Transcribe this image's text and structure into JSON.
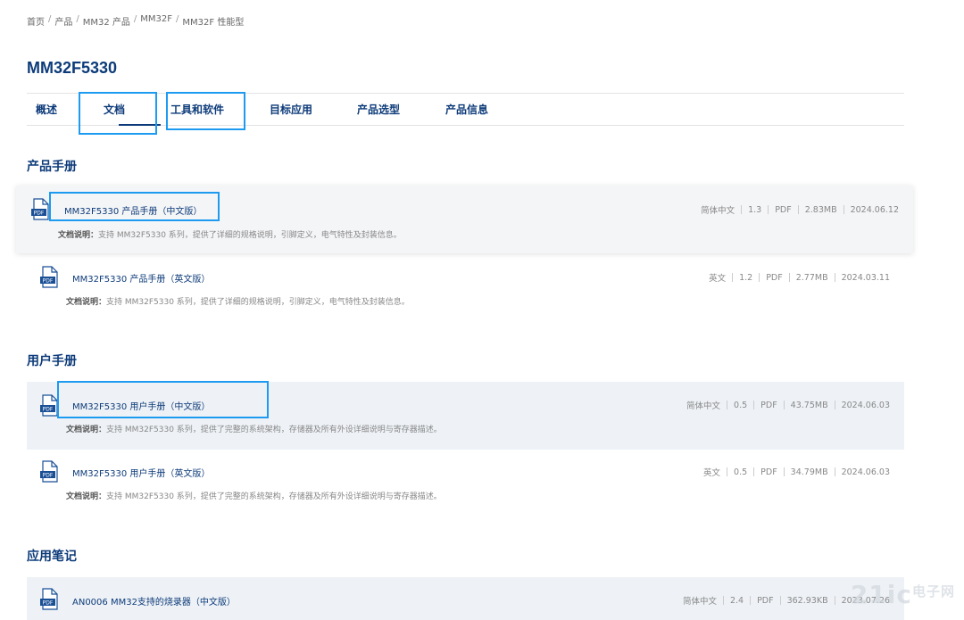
{
  "breadcrumb": [
    "首页",
    "产品",
    "MM32 产品",
    "MM32F",
    "MM32F 性能型"
  ],
  "page_title": "MM32F5330",
  "tabs": [
    "概述",
    "文档",
    "工具和软件",
    "目标应用",
    "产品选型",
    "产品信息"
  ],
  "desc_prefix": "文档说明：",
  "sections": [
    {
      "title": "产品手册",
      "docs": [
        {
          "title": "MM32F5330 产品手册（中文版）",
          "lang": "简体中文",
          "ver": "1.3",
          "fmt": "PDF",
          "size": "2.83MB",
          "date": "2024.06.12",
          "desc": "支持 MM32F5330 系列，提供了详细的规格说明，引脚定义，电气特性及封装信息。"
        },
        {
          "title": "MM32F5330 产品手册（英文版）",
          "lang": "英文",
          "ver": "1.2",
          "fmt": "PDF",
          "size": "2.77MB",
          "date": "2024.03.11",
          "desc": "支持 MM32F5330 系列，提供了详细的规格说明，引脚定义，电气特性及封装信息。"
        }
      ]
    },
    {
      "title": "用户手册",
      "docs": [
        {
          "title": "MM32F5330 用户手册（中文版）",
          "lang": "简体中文",
          "ver": "0.5",
          "fmt": "PDF",
          "size": "43.75MB",
          "date": "2024.06.03",
          "desc": "支持 MM32F5330 系列，提供了完整的系统架构，存储器及所有外设详细说明与寄存器描述。"
        },
        {
          "title": "MM32F5330 用户手册（英文版）",
          "lang": "英文",
          "ver": "0.5",
          "fmt": "PDF",
          "size": "34.79MB",
          "date": "2024.06.03",
          "desc": "支持 MM32F5330 系列，提供了完整的系统架构，存储器及所有外设详细说明与寄存器描述。"
        }
      ]
    },
    {
      "title": "应用笔记",
      "docs": [
        {
          "title": "AN0006 MM32支持的烧录器（中文版）",
          "lang": "简体中文",
          "ver": "2.4",
          "fmt": "PDF",
          "size": "362.93KB",
          "date": "2023.07.26"
        }
      ]
    }
  ],
  "icon_label": "PDF",
  "watermark": {
    "main": "21ic",
    "sub": "电子网"
  },
  "colors": {
    "brand": "#0d3b7a",
    "highlight": "#1d9bf0",
    "row_alt": "#eef2f6"
  }
}
